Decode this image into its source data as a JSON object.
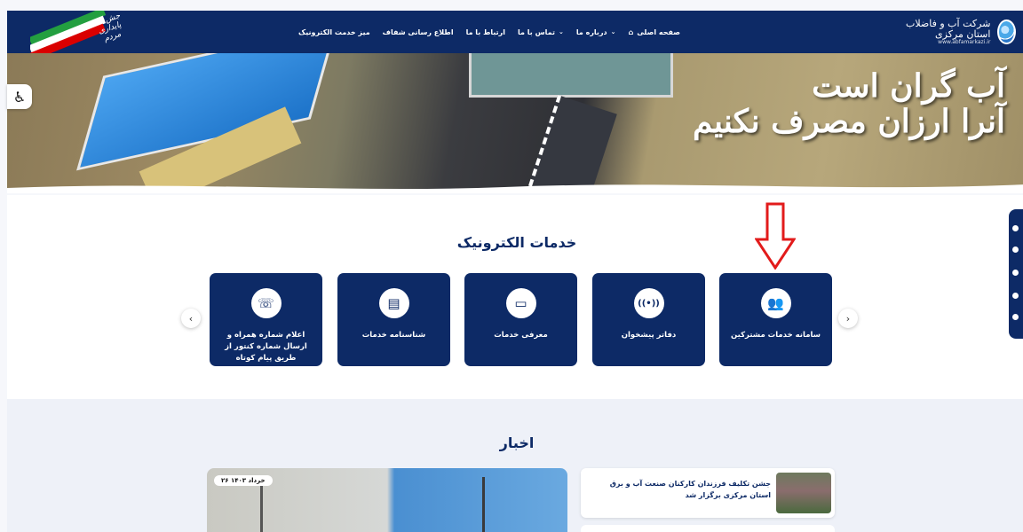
{
  "header": {
    "logo_title": "شرکت آب و فاضلاب استان مرکزی",
    "logo_url": "www.abfamarkazi.ir",
    "nav": [
      {
        "label": "صفحه اصلی",
        "icon": "home-icon",
        "dropdown": false
      },
      {
        "label": "درباره ما",
        "dropdown": true
      },
      {
        "label": "تماس با ما",
        "dropdown": true
      },
      {
        "label": "ارتباط با ما",
        "dropdown": false
      },
      {
        "label": "اطلاع رسانی شفاف",
        "dropdown": false
      },
      {
        "label": "میز خدمت الکترونیک",
        "dropdown": false
      }
    ],
    "flag_text": "جش تا ا پایداری مردم"
  },
  "hero": {
    "slogan_line1": "آب گران است",
    "slogan_line2": "آنرا ارزان مصرف نکنیم"
  },
  "services": {
    "title": "خدمات الکترونیک",
    "cards": [
      {
        "label": "سامانه خدمات مشترکین",
        "icon": "users-icon",
        "glyph": "👥"
      },
      {
        "label": "دفاتر پیشخوان",
        "icon": "signal-icon",
        "glyph": "((•))"
      },
      {
        "label": "معرفی خدمات",
        "icon": "presentation-icon",
        "glyph": "▭"
      },
      {
        "label": "شناسنامه خدمات",
        "icon": "document-icon",
        "glyph": "▤"
      },
      {
        "label": "اعلام شماره همراه و ارسال شماره کنتور از طریق پیام کوتاه",
        "icon": "phone-icon",
        "glyph": "☏"
      }
    ],
    "prev_label": "‹",
    "next_label": "›"
  },
  "news": {
    "title": "اخبار",
    "featured_date": "۲۶ خرداد ۱۴۰۳",
    "items": [
      {
        "title": "جشن تکلیف فرزندان کارکنان صنعت آب و برق استان مرکزی برگزار شد"
      }
    ]
  },
  "colors": {
    "primary": "#0d2a66",
    "annotation": "#e21b1b"
  }
}
